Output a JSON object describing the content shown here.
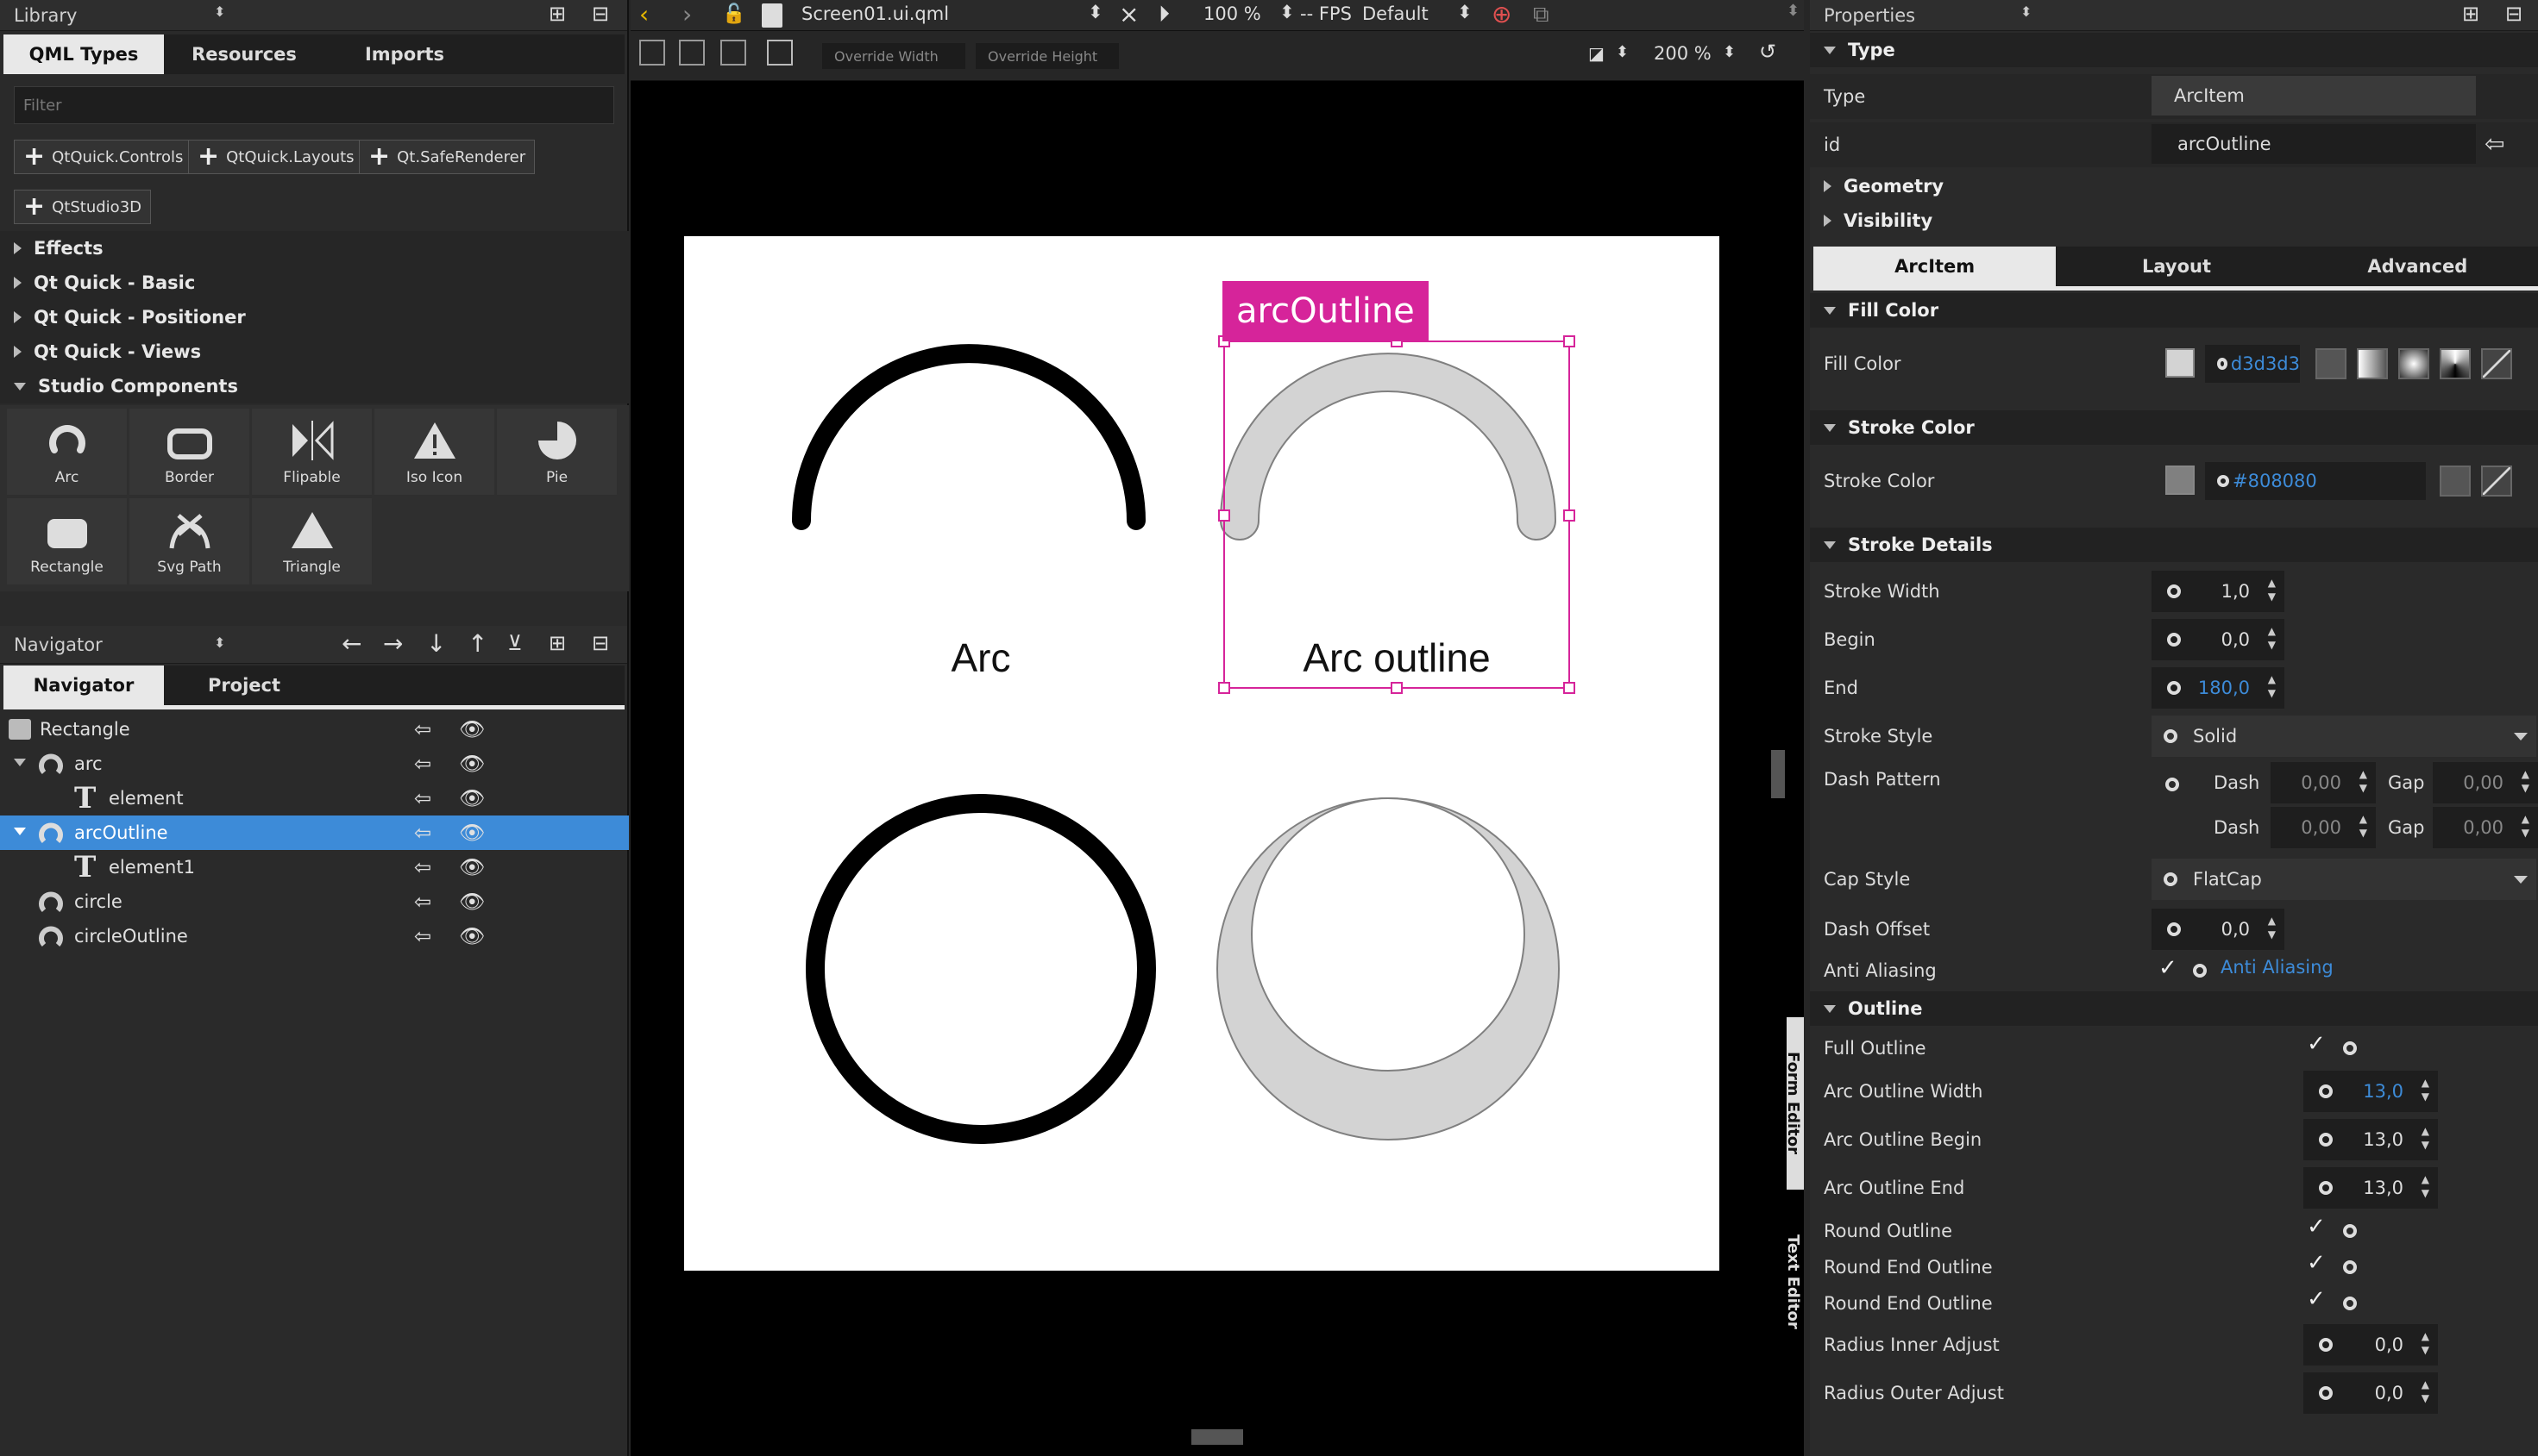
{
  "library": {
    "panel_title": "Library",
    "tabs": [
      "QML Types",
      "Resources",
      "Imports"
    ],
    "filter_placeholder": "Filter",
    "imports": [
      "QtQuick.Controls",
      "QtQuick.Layouts",
      "Qt.SafeRenderer",
      "QtStudio3D"
    ],
    "sections": [
      "Effects",
      "Qt Quick - Basic",
      "Qt Quick - Positioner",
      "Qt Quick - Views",
      "Studio Components"
    ],
    "components": [
      "Arc",
      "Border",
      "Flipable",
      "Iso Icon",
      "Pie",
      "Rectangle",
      "Svg Path",
      "Triangle"
    ]
  },
  "navigator": {
    "panel_title": "Navigator",
    "tabs": [
      "Navigator",
      "Project"
    ],
    "items": [
      "Rectangle",
      "arc",
      "element",
      "arcOutline",
      "element1",
      "circle",
      "circleOutline"
    ]
  },
  "editor": {
    "filename": "Screen01.ui.qml",
    "zoom": "100 %",
    "fps": "-- FPS",
    "state": "Default",
    "override_width": "Override Width",
    "override_height": "Override Height",
    "canvas_zoom": "200 %",
    "selection_label": "arcOutline",
    "label_arc": "Arc",
    "label_arc_outline": "Arc outline",
    "side_tabs": [
      "Form Editor",
      "Text Editor"
    ]
  },
  "properties": {
    "panel_title": "Properties",
    "type_header": "Type",
    "type_label": "Type",
    "type_value": "ArcItem",
    "id_label": "id",
    "id_value": "arcOutline",
    "geometry": "Geometry",
    "visibility": "Visibility",
    "tabs": [
      "ArcItem",
      "Layout",
      "Advanced"
    ],
    "fill_color_header": "Fill Color",
    "fill_color_label": "Fill Color",
    "fill_color_value": "d3d3d3",
    "fill_color_hex": "#d3d3d3",
    "stroke_color_header": "Stroke Color",
    "stroke_color_label": "Stroke Color",
    "stroke_color_value": "#808080",
    "stroke_details_header": "Stroke Details",
    "stroke_width_label": "Stroke Width",
    "stroke_width": "1,0",
    "begin_label": "Begin",
    "begin": "0,0",
    "end_label": "End",
    "end": "180,0",
    "stroke_style_label": "Stroke Style",
    "stroke_style": "Solid",
    "dash_pattern_label": "Dash Pattern",
    "dash_label": "Dash",
    "gap_label": "Gap",
    "dash_values": [
      "0,00",
      "0,00",
      "0,00",
      "0,00"
    ],
    "cap_style_label": "Cap Style",
    "cap_style": "FlatCap",
    "dash_offset_label": "Dash Offset",
    "dash_offset": "0,0",
    "anti_aliasing_label": "Anti Aliasing",
    "anti_aliasing_check": "Anti Aliasing",
    "outline_header": "Outline",
    "full_outline": "Full Outline",
    "arc_outline_width_label": "Arc Outline Width",
    "arc_outline_width": "13,0",
    "arc_outline_begin_label": "Arc Outline Begin",
    "arc_outline_begin": "13,0",
    "arc_outline_end_label": "Arc Outline End",
    "arc_outline_end": "13,0",
    "round_outline": "Round Outline",
    "round_end_outline_1": "Round End Outline",
    "round_end_outline_2": "Round End Outline",
    "radius_inner_label": "Radius Inner Adjust",
    "radius_inner": "0,0",
    "radius_outer_label": "Radius Outer Adjust",
    "radius_outer": "0,0"
  },
  "colors": {
    "accent": "#3d8bd8",
    "selection": "#d6249a"
  }
}
